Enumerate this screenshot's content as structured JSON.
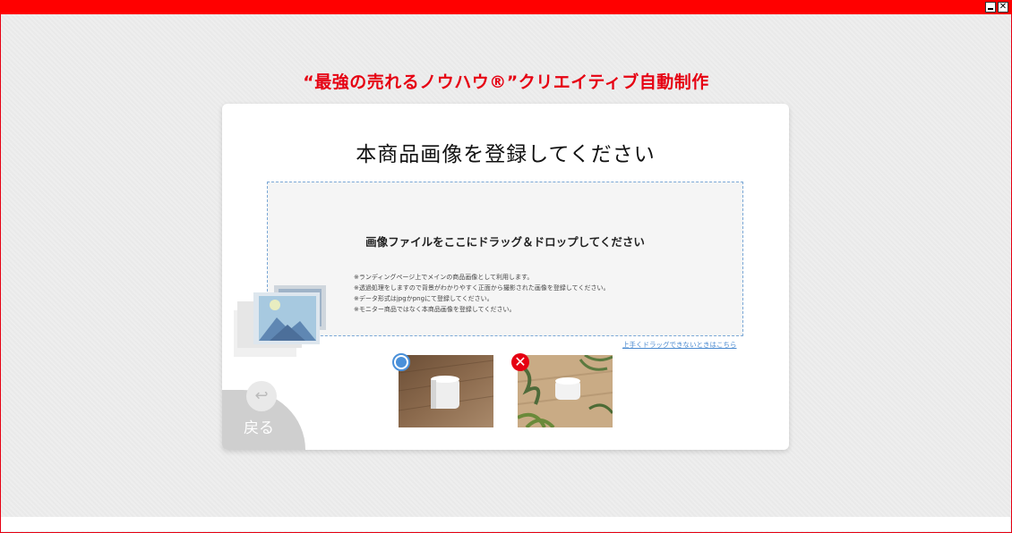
{
  "window": {
    "minimize_icon": "minimize-icon",
    "close_symbol": "✕",
    "accent_color": "#ff0000"
  },
  "app_title": "“最強の売れるノウハウ®”クリエイティブ自動制作",
  "card": {
    "title": "本商品画像を登録してください",
    "dropzone": {
      "main_text": "画像ファイルをここにドラッグ＆ドロップしてください",
      "notes": [
        "※ランディングページ上でメインの商品画像として利用します。",
        "※透過処理をしますので背景がわかりやすく正面から撮影された画像を登録してください。",
        "※データ形式はjpgかpngにて登録してください。",
        "※モニター商品ではなく本商品画像を登録してください。"
      ]
    },
    "help_link": "上手くドラッグできないときはこちら",
    "examples": {
      "good_icon": "check-circle-icon",
      "bad_symbol": "✕"
    },
    "back": {
      "icon_symbol": "↩",
      "label": "戻る"
    }
  }
}
